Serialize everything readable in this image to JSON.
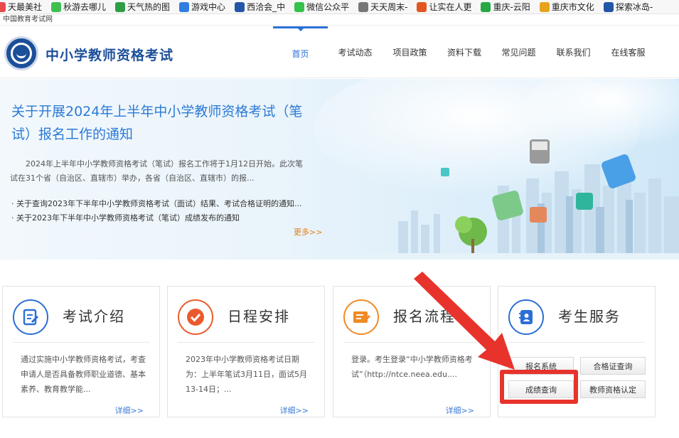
{
  "bookmarks": [
    {
      "label": "天最美社",
      "color": "#e94b4b"
    },
    {
      "label": "秋游去哪儿",
      "color": "#3fbf4f"
    },
    {
      "label": "天气热的图",
      "color": "#2f9e44"
    },
    {
      "label": "游戏中心",
      "color": "#2f7de1"
    },
    {
      "label": "西洽会_中",
      "color": "#2456a6"
    },
    {
      "label": "微信公众平",
      "color": "#35c14a"
    },
    {
      "label": "天天周末-",
      "color": "#777777"
    },
    {
      "label": "让实在人更",
      "color": "#e2561f"
    },
    {
      "label": "重庆-云阳",
      "color": "#27a844"
    },
    {
      "label": "重庆市文化",
      "color": "#e8a31c"
    },
    {
      "label": "探索冰岛-",
      "color": "#2456a6"
    }
  ],
  "site_tag": "中国教育考试网",
  "header": {
    "title": "中小学教师资格考试",
    "nav": [
      "首页",
      "考试动态",
      "项目政策",
      "资料下载",
      "常见问题",
      "联系我们",
      "在线客服"
    ]
  },
  "banner": {
    "title": "关于开展2024年上半年中小学教师资格考试（笔试）报名工作的通知",
    "desc": "2024年上半年中小学教师资格考试（笔试）报名工作将于1月12日开始。此次笔试在31个省（自治区、直辖市）举办，各省（自治区、直辖市）的报...",
    "links": [
      "· 关于查询2023年下半年中小学教师资格考试（面试）结果、考试合格证明的通知...",
      "· 关于2023年下半年中小学教师资格考试（笔试）成绩发布的通知"
    ],
    "more": "更多>>"
  },
  "cards": [
    {
      "title": "考试介绍",
      "text": "通过实施中小学教师资格考试，考查申请人是否具备教师职业道德、基本素养、教育教学能...",
      "more": "详细>>",
      "color": "#2b6fd6"
    },
    {
      "title": "日程安排",
      "text": "2023年中小学教师资格考试日期为：上半年笔试3月11日，面试5月13-14日；...",
      "more": "详细>>",
      "color": "#ea5a2c"
    },
    {
      "title": "报名流程",
      "text": "登录。考生登录“中小学教师资格考试”（http://ntce.neea.edu....",
      "more": "详细>>",
      "color": "#f08a24"
    },
    {
      "title": "考生服务",
      "color": "#2b6fd6"
    }
  ],
  "services": {
    "buttons": [
      "报名系统",
      "合格证查询",
      "成绩查询",
      "教师资格认定"
    ]
  }
}
